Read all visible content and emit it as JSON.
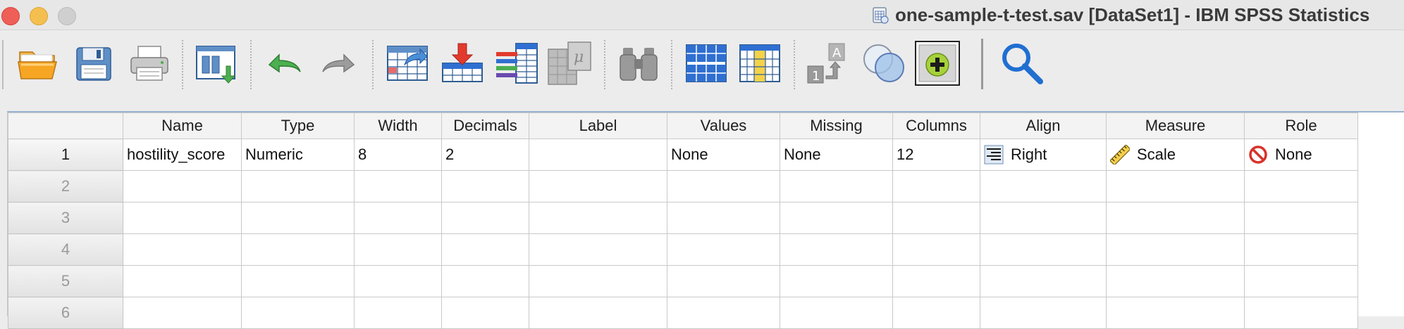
{
  "window": {
    "title": "one-sample-t-test.sav [DataSet1] - IBM SPSS Statistics"
  },
  "toolbar": {
    "buttons": [
      {
        "name": "open-data-document",
        "icon": "folder-open-icon"
      },
      {
        "name": "save-document",
        "icon": "floppy-disk-icon"
      },
      {
        "name": "print",
        "icon": "printer-icon"
      },
      {
        "name": "recall-dialog",
        "icon": "recall-dialog-icon"
      },
      {
        "name": "undo",
        "icon": "undo-icon"
      },
      {
        "name": "redo",
        "icon": "redo-icon"
      },
      {
        "name": "go-to-case",
        "icon": "go-to-case-icon"
      },
      {
        "name": "go-to-variable",
        "icon": "go-to-variable-icon"
      },
      {
        "name": "variables",
        "icon": "variables-icon"
      },
      {
        "name": "run-descriptive-statistics",
        "icon": "descriptive-stats-icon"
      },
      {
        "name": "find",
        "icon": "binoculars-icon"
      },
      {
        "name": "insert-cases",
        "icon": "insert-cases-icon"
      },
      {
        "name": "insert-variable",
        "icon": "insert-variable-icon"
      },
      {
        "name": "split-file",
        "icon": "split-file-icon"
      },
      {
        "name": "select-cases",
        "icon": "select-cases-icon"
      },
      {
        "name": "value-labels",
        "icon": "value-labels-icon"
      },
      {
        "name": "search",
        "icon": "magnifier-icon"
      }
    ]
  },
  "grid": {
    "columns": [
      "Name",
      "Type",
      "Width",
      "Decimals",
      "Label",
      "Values",
      "Missing",
      "Columns",
      "Align",
      "Measure",
      "Role"
    ],
    "row_numbers": [
      "1",
      "2",
      "3",
      "4",
      "5",
      "6"
    ],
    "variables": [
      {
        "name": "hostility_score",
        "type": "Numeric",
        "width": "8",
        "decimals": "2",
        "label": "",
        "values": "None",
        "missing": "None",
        "columns": "12",
        "align": "Right",
        "align_icon": "align-right-icon",
        "measure": "Scale",
        "measure_icon": "ruler-icon",
        "role": "None",
        "role_icon": "no-entry-icon"
      }
    ]
  },
  "colors": {
    "grid_border": "#c9c9c9",
    "header_bg": "#f3f3f3",
    "accent_blue": "#1f6fd1",
    "role_none_red": "#d8322a"
  }
}
